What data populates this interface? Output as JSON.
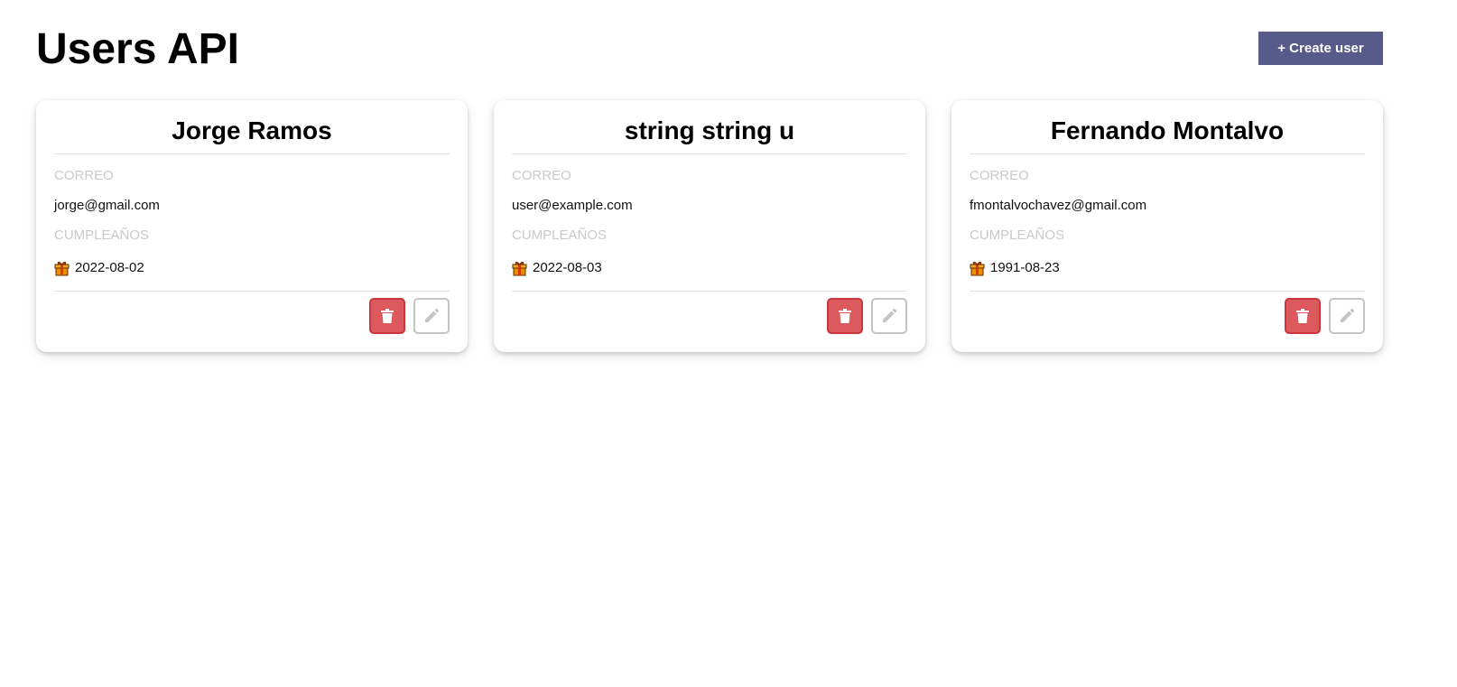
{
  "header": {
    "title": "Users API",
    "create_button_label": "+ Create user"
  },
  "labels": {
    "email": "CORREO",
    "birthday": "CUMPLEAÑOS"
  },
  "users": [
    {
      "name": "Jorge Ramos",
      "email": "jorge@gmail.com",
      "birthday": "2022-08-02"
    },
    {
      "name": "string string u",
      "email": "user@example.com",
      "birthday": "2022-08-03"
    },
    {
      "name": "Fernando Montalvo",
      "email": "fmontalvochavez@gmail.com",
      "birthday": "1991-08-23"
    }
  ],
  "colors": {
    "create_button_bg": "#565b8a",
    "delete_button_bg": "#dc5a5e",
    "delete_button_border": "#c8383d",
    "edit_button_border": "#c4c4c4",
    "label_text": "#c9c9c9"
  },
  "icons": {
    "delete": "trash-icon",
    "edit": "pencil-icon",
    "birthday": "gift-icon"
  }
}
